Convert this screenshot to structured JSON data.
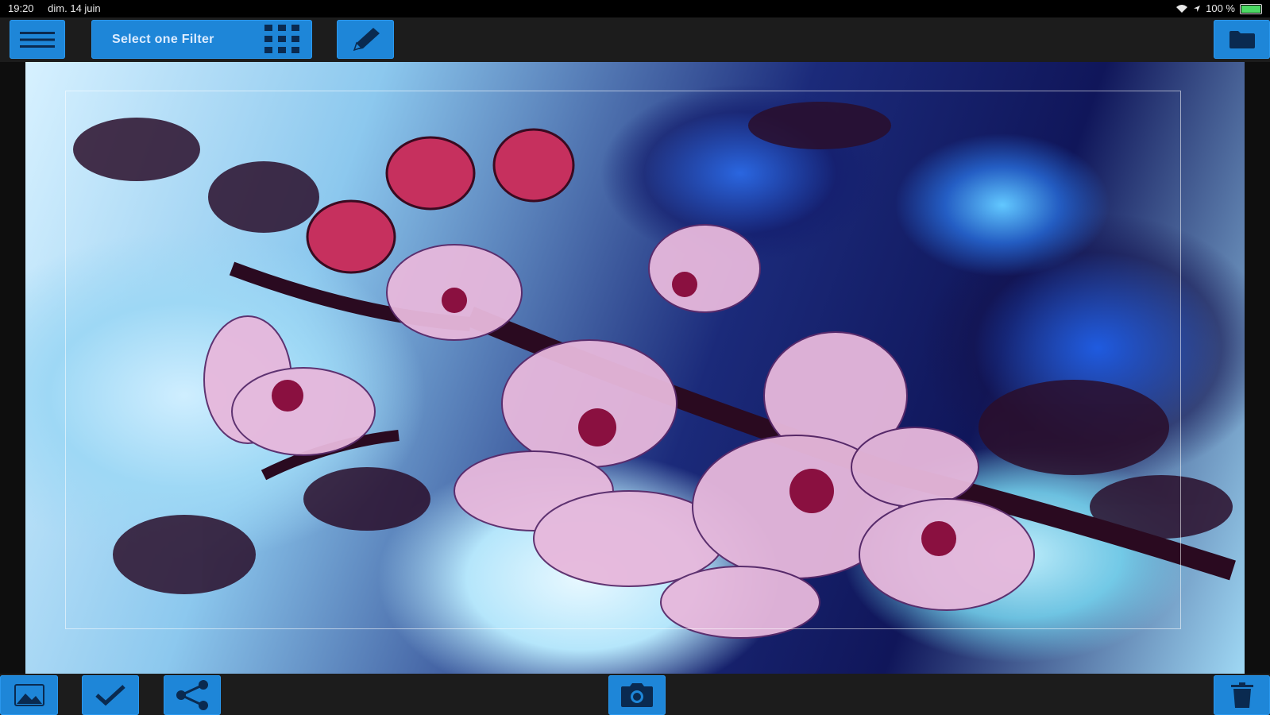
{
  "status_bar": {
    "time": "19:20",
    "date": "dim. 14 juin",
    "battery": "100 %"
  },
  "toolbar": {
    "filter_button_label": "Select one Filter"
  },
  "icons": {
    "menu": "hamburger-menu-icon",
    "grid": "grid-icon",
    "edit": "pencil-icon",
    "folder": "folder-icon",
    "gallery": "image-icon",
    "confirm": "checkmark-icon",
    "share": "share-icon",
    "camera": "camera-icon",
    "delete": "trash-icon"
  },
  "colors": {
    "accent": "#1e86d8",
    "toolbar_bg": "#1c1c1c",
    "statusbar_bg": "#000000"
  }
}
